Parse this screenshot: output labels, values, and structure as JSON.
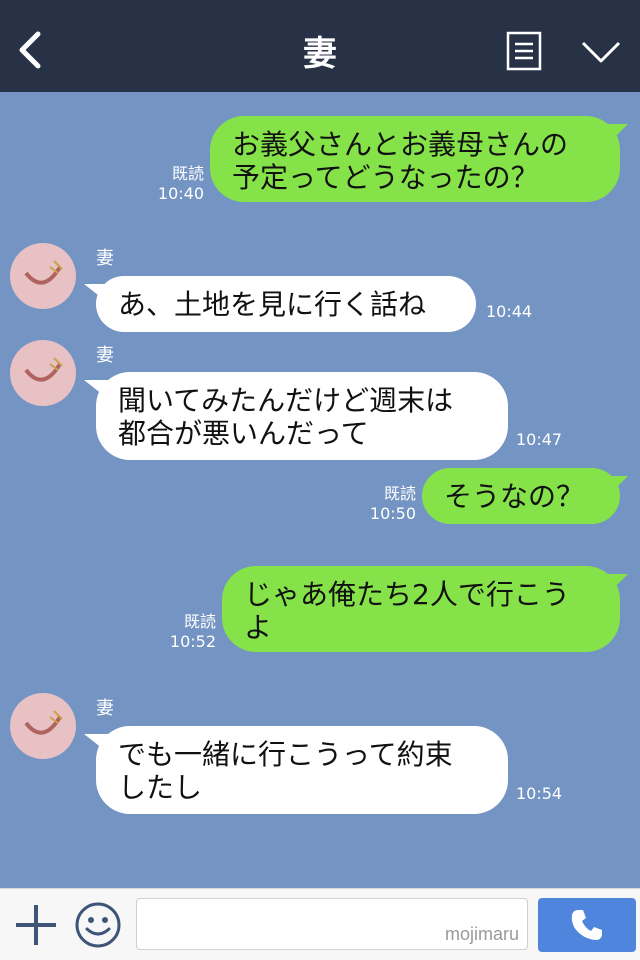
{
  "header": {
    "title": "妻"
  },
  "messages": [
    {
      "sender": "",
      "text": "お義父さんとお義母さんの\n予定ってどうなったの？",
      "read": "既読",
      "time": "10:40"
    },
    {
      "sender": "妻",
      "text": "あ、土地を見に行く話ね",
      "read": "",
      "time": "10:44"
    },
    {
      "sender": "妻",
      "text": "聞いてみたんだけど週末は\n都合が悪いんだって",
      "read": "",
      "time": "10:47"
    },
    {
      "sender": "",
      "text": "そうなの？",
      "read": "既読",
      "time": "10:50"
    },
    {
      "sender": "",
      "text": "じゃあ俺たち2人で行こう\nよ",
      "read": "既読",
      "time": "10:52"
    },
    {
      "sender": "妻",
      "text": "でも一緒に行こうって約束\nしたし",
      "read": "",
      "time": "10:54"
    }
  ],
  "input": {
    "watermark": "mojimaru"
  },
  "colors": {
    "header_bg": "#273246",
    "chat_bg": "#7494c3",
    "outgoing_bubble": "#85e249",
    "incoming_bubble": "#ffffff",
    "call_button": "#4f85dd"
  },
  "icons": [
    "back-icon",
    "menu-icon",
    "chevron-down-icon",
    "plus-icon",
    "smiley-icon",
    "phone-icon"
  ]
}
